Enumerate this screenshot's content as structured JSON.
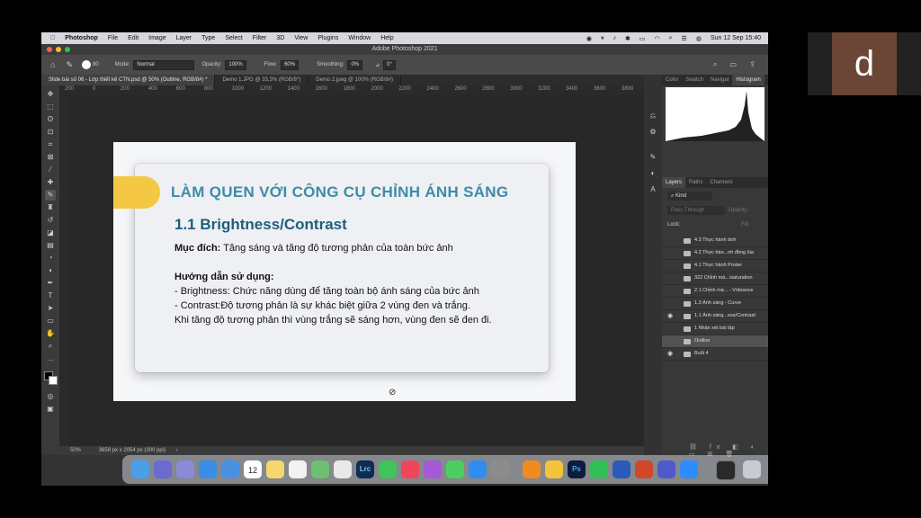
{
  "avatar": {
    "letter": "d"
  },
  "menubar": {
    "apple_icon": "apple-icon",
    "items": [
      "Photoshop",
      "File",
      "Edit",
      "Image",
      "Layer",
      "Type",
      "Select",
      "Filter",
      "3D",
      "View",
      "Plugins",
      "Window",
      "Help"
    ],
    "clock": "Sun 12 Sep  15:40"
  },
  "window": {
    "title": "Adobe Photoshop 2021"
  },
  "options": {
    "mode_label": "Mode:",
    "mode_value": "Normal",
    "opacity_label": "Opacity:",
    "opacity_value": "100%",
    "flow_label": "Flow:",
    "flow_value": "60%",
    "smoothing_label": "Smoothing:",
    "smoothing_value": "0%",
    "angle_value": "0°",
    "brush_size": "80"
  },
  "tabs": [
    {
      "label": "Slide bài số 06 - Lớp thiết kế CTN.psd @ 50% (Outline, RGB/8#) *"
    },
    {
      "label": "Demo 1.JPG @ 33,3% (RGB/8*)"
    },
    {
      "label": "Demo 2.jpeg @ 100% (RGB/8#)"
    }
  ],
  "ruler": {
    "ticks": [
      "200",
      "0",
      "200",
      "400",
      "600",
      "800",
      "1000",
      "1200",
      "1400",
      "1600",
      "1800",
      "2000",
      "2200",
      "2400",
      "2600",
      "2800",
      "3000",
      "3200",
      "3400",
      "3600",
      "3800"
    ]
  },
  "status": {
    "zoom": "50%",
    "doc_size": "3658 px x 2054 px (300 ppi)"
  },
  "slide": {
    "title": "LÀM QUEN VỚI CÔNG CỤ CHỈNH ÁNH SÁNG",
    "subtitle": "1.1 Brightness/Contrast",
    "purpose_label": "Mục đích:",
    "purpose_text": " Tăng sáng và tăng độ tương phản của toàn bức ảnh",
    "guide_label": "Hướng dẫn sử dụng:",
    "line1": "- Brightness: Chức năng dùng để tăng toàn bộ ánh sáng của bức ảnh",
    "line2": "- Contrast:Độ tương phản là sự khác biệt giữa 2 vùng đen và trắng.",
    "line3": "Khi tăng độ tương phản thì vùng trắng sẽ sáng hơn, vùng đen sẽ đen đi."
  },
  "panels": {
    "top_tabs": [
      "Color",
      "Swatch",
      "Navigat",
      "Histogram"
    ],
    "layer_tabs": [
      "Layers",
      "Paths",
      "Channels"
    ],
    "kind_label": "Kind",
    "blend_mode": "Pass Through",
    "opacity_label": "Opacity:",
    "lock_label": "Lock:",
    "fill_label": "Fill:",
    "layers": [
      {
        "name": "4.3 Thực hành ảnh",
        "visible": false,
        "active": false
      },
      {
        "name": "4.2 Thực hàn...nh đồng lúa",
        "visible": false,
        "active": false
      },
      {
        "name": "4.1 Thực hành Poster",
        "visible": false,
        "active": false
      },
      {
        "name": "322 Chỉnh mà.../saturation",
        "visible": false,
        "active": false
      },
      {
        "name": "2.1 Chỉnh mà... - Vribrance",
        "visible": false,
        "active": false
      },
      {
        "name": "1.3 Ánh sáng - Curve",
        "visible": false,
        "active": false
      },
      {
        "name": "1.1 Ánh sáng...ess/Contrast",
        "visible": true,
        "active": false
      },
      {
        "name": "1 Nhận xét bài tập",
        "visible": false,
        "active": false
      },
      {
        "name": "Outline",
        "visible": false,
        "active": true
      },
      {
        "name": "Buổi 4",
        "visible": true,
        "active": false
      }
    ]
  },
  "dock": {
    "icons": [
      "finder-icon",
      "launchpad-icon",
      "apps-icon",
      "safari-icon",
      "mail-icon",
      "calendar-icon",
      "notes-icon",
      "reminders-icon",
      "maps-icon",
      "chrome-icon",
      "lightroom-icon",
      "facetime-icon",
      "music-icon",
      "podcasts-icon",
      "messages-icon",
      "appstore-icon",
      "settings-icon",
      "vlc-icon",
      "drawing-icon",
      "photoshop-icon",
      "whatsapp-icon",
      "word-icon",
      "powerpoint-icon",
      "teams-icon",
      "zoom-icon",
      "screen-icon",
      "trash-icon"
    ],
    "calendar_day": "12",
    "lrc_label": "Lrc",
    "ps_label": "Ps"
  }
}
